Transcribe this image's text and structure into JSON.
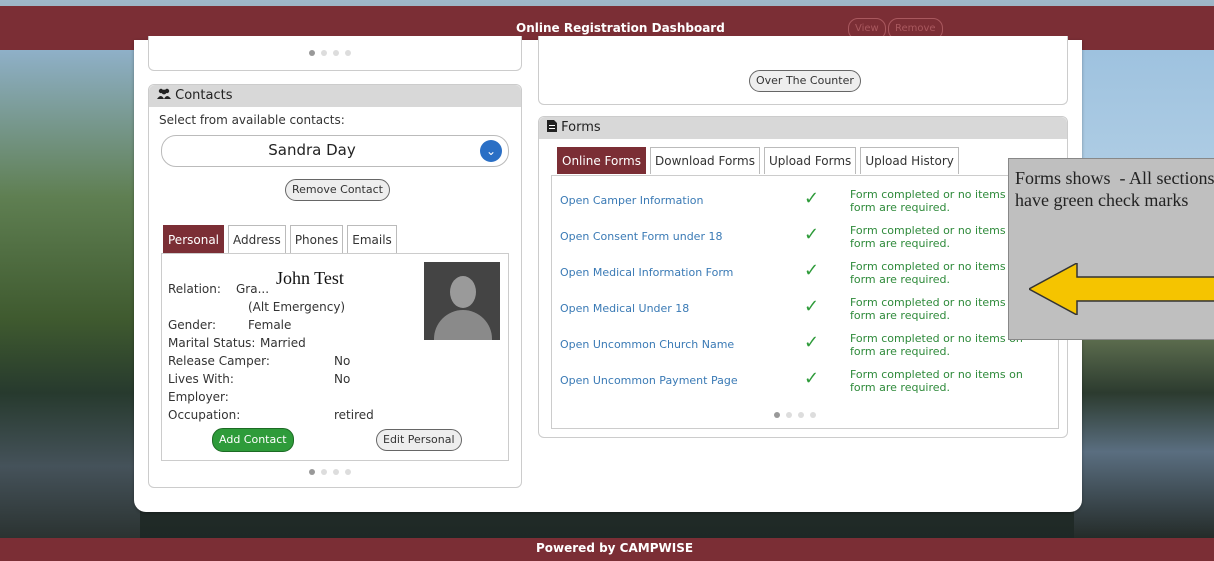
{
  "header": {
    "title": "Online Registration Dashboard",
    "view_label": "View",
    "remove_label": "Remove"
  },
  "footer": {
    "text": "Powered by CAMPWISE"
  },
  "left": {
    "contacts_title": "Contacts",
    "select_label": "Select from available contacts:",
    "selected_contact": "Sandra Day",
    "remove_contact_label": "Remove Contact",
    "tabs": [
      "Personal",
      "Address",
      "Phones",
      "Emails"
    ],
    "overlay_name": "John Test",
    "relation_label": "Relation:",
    "relation_value": "Gra...",
    "relation_note": "(Alt Emergency)",
    "gender_label": "Gender:",
    "gender_value": "Female",
    "marital_label": "Marital Status:",
    "marital_value": "Married",
    "release_label": "Release Camper:",
    "release_value": "No",
    "lives_label": "Lives With:",
    "lives_value": "No",
    "employer_label": "Employer:",
    "occupation_label": "Occupation:",
    "occupation_value": "retired",
    "add_contact_label": "Add Contact",
    "edit_personal_label": "Edit Personal"
  },
  "right": {
    "over_counter_label": "Over The Counter",
    "forms_title": "Forms",
    "tabs": [
      "Online Forms",
      "Download Forms",
      "Upload Forms",
      "Upload History"
    ],
    "forms": [
      {
        "name": "Open Camper Information",
        "status": "Form completed or no items on form are required."
      },
      {
        "name": "Open Consent Form under 18",
        "status": "Form completed or no items on form are required."
      },
      {
        "name": "Open Medical Information Form",
        "status": "Form completed or no items on form are required."
      },
      {
        "name": "Open Medical Under 18",
        "status": "Form completed or no items on form are required."
      },
      {
        "name": "Open Uncommon Church Name",
        "status": "Form completed or no items on form are required."
      },
      {
        "name": "Open Uncommon Payment Page",
        "status": "Form completed or no items on form are required."
      }
    ]
  },
  "annotation": {
    "text": "Forms shows  - All sections have green check marks"
  },
  "colors": {
    "brand": "#7b2e35",
    "link": "#3a7ab5",
    "success": "#2e9b3a",
    "select_icon": "#2a6fc5"
  },
  "icons": {
    "contacts": "users-icon",
    "forms": "file-icon",
    "dropdown": "chevron-down-icon",
    "check": "checkmark-icon",
    "arrow": "arrow-left-icon"
  }
}
